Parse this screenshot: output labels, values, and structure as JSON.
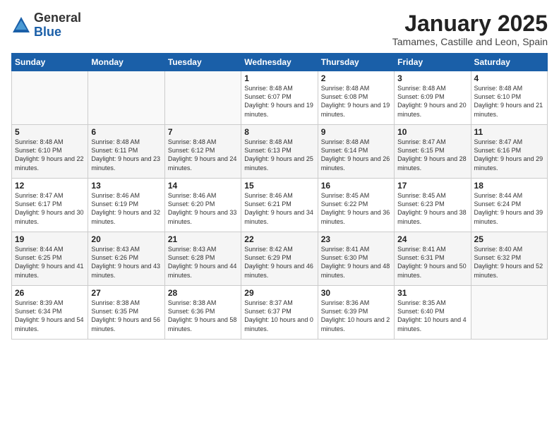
{
  "header": {
    "logo_general": "General",
    "logo_blue": "Blue",
    "month_title": "January 2025",
    "location": "Tamames, Castille and Leon, Spain"
  },
  "weekdays": [
    "Sunday",
    "Monday",
    "Tuesday",
    "Wednesday",
    "Thursday",
    "Friday",
    "Saturday"
  ],
  "weeks": [
    [
      {
        "day": "",
        "sunrise": "",
        "sunset": "",
        "daylight": ""
      },
      {
        "day": "",
        "sunrise": "",
        "sunset": "",
        "daylight": ""
      },
      {
        "day": "",
        "sunrise": "",
        "sunset": "",
        "daylight": ""
      },
      {
        "day": "1",
        "sunrise": "Sunrise: 8:48 AM",
        "sunset": "Sunset: 6:07 PM",
        "daylight": "Daylight: 9 hours and 19 minutes."
      },
      {
        "day": "2",
        "sunrise": "Sunrise: 8:48 AM",
        "sunset": "Sunset: 6:08 PM",
        "daylight": "Daylight: 9 hours and 19 minutes."
      },
      {
        "day": "3",
        "sunrise": "Sunrise: 8:48 AM",
        "sunset": "Sunset: 6:09 PM",
        "daylight": "Daylight: 9 hours and 20 minutes."
      },
      {
        "day": "4",
        "sunrise": "Sunrise: 8:48 AM",
        "sunset": "Sunset: 6:10 PM",
        "daylight": "Daylight: 9 hours and 21 minutes."
      }
    ],
    [
      {
        "day": "5",
        "sunrise": "Sunrise: 8:48 AM",
        "sunset": "Sunset: 6:10 PM",
        "daylight": "Daylight: 9 hours and 22 minutes."
      },
      {
        "day": "6",
        "sunrise": "Sunrise: 8:48 AM",
        "sunset": "Sunset: 6:11 PM",
        "daylight": "Daylight: 9 hours and 23 minutes."
      },
      {
        "day": "7",
        "sunrise": "Sunrise: 8:48 AM",
        "sunset": "Sunset: 6:12 PM",
        "daylight": "Daylight: 9 hours and 24 minutes."
      },
      {
        "day": "8",
        "sunrise": "Sunrise: 8:48 AM",
        "sunset": "Sunset: 6:13 PM",
        "daylight": "Daylight: 9 hours and 25 minutes."
      },
      {
        "day": "9",
        "sunrise": "Sunrise: 8:48 AM",
        "sunset": "Sunset: 6:14 PM",
        "daylight": "Daylight: 9 hours and 26 minutes."
      },
      {
        "day": "10",
        "sunrise": "Sunrise: 8:47 AM",
        "sunset": "Sunset: 6:15 PM",
        "daylight": "Daylight: 9 hours and 28 minutes."
      },
      {
        "day": "11",
        "sunrise": "Sunrise: 8:47 AM",
        "sunset": "Sunset: 6:16 PM",
        "daylight": "Daylight: 9 hours and 29 minutes."
      }
    ],
    [
      {
        "day": "12",
        "sunrise": "Sunrise: 8:47 AM",
        "sunset": "Sunset: 6:17 PM",
        "daylight": "Daylight: 9 hours and 30 minutes."
      },
      {
        "day": "13",
        "sunrise": "Sunrise: 8:46 AM",
        "sunset": "Sunset: 6:19 PM",
        "daylight": "Daylight: 9 hours and 32 minutes."
      },
      {
        "day": "14",
        "sunrise": "Sunrise: 8:46 AM",
        "sunset": "Sunset: 6:20 PM",
        "daylight": "Daylight: 9 hours and 33 minutes."
      },
      {
        "day": "15",
        "sunrise": "Sunrise: 8:46 AM",
        "sunset": "Sunset: 6:21 PM",
        "daylight": "Daylight: 9 hours and 34 minutes."
      },
      {
        "day": "16",
        "sunrise": "Sunrise: 8:45 AM",
        "sunset": "Sunset: 6:22 PM",
        "daylight": "Daylight: 9 hours and 36 minutes."
      },
      {
        "day": "17",
        "sunrise": "Sunrise: 8:45 AM",
        "sunset": "Sunset: 6:23 PM",
        "daylight": "Daylight: 9 hours and 38 minutes."
      },
      {
        "day": "18",
        "sunrise": "Sunrise: 8:44 AM",
        "sunset": "Sunset: 6:24 PM",
        "daylight": "Daylight: 9 hours and 39 minutes."
      }
    ],
    [
      {
        "day": "19",
        "sunrise": "Sunrise: 8:44 AM",
        "sunset": "Sunset: 6:25 PM",
        "daylight": "Daylight: 9 hours and 41 minutes."
      },
      {
        "day": "20",
        "sunrise": "Sunrise: 8:43 AM",
        "sunset": "Sunset: 6:26 PM",
        "daylight": "Daylight: 9 hours and 43 minutes."
      },
      {
        "day": "21",
        "sunrise": "Sunrise: 8:43 AM",
        "sunset": "Sunset: 6:28 PM",
        "daylight": "Daylight: 9 hours and 44 minutes."
      },
      {
        "day": "22",
        "sunrise": "Sunrise: 8:42 AM",
        "sunset": "Sunset: 6:29 PM",
        "daylight": "Daylight: 9 hours and 46 minutes."
      },
      {
        "day": "23",
        "sunrise": "Sunrise: 8:41 AM",
        "sunset": "Sunset: 6:30 PM",
        "daylight": "Daylight: 9 hours and 48 minutes."
      },
      {
        "day": "24",
        "sunrise": "Sunrise: 8:41 AM",
        "sunset": "Sunset: 6:31 PM",
        "daylight": "Daylight: 9 hours and 50 minutes."
      },
      {
        "day": "25",
        "sunrise": "Sunrise: 8:40 AM",
        "sunset": "Sunset: 6:32 PM",
        "daylight": "Daylight: 9 hours and 52 minutes."
      }
    ],
    [
      {
        "day": "26",
        "sunrise": "Sunrise: 8:39 AM",
        "sunset": "Sunset: 6:34 PM",
        "daylight": "Daylight: 9 hours and 54 minutes."
      },
      {
        "day": "27",
        "sunrise": "Sunrise: 8:38 AM",
        "sunset": "Sunset: 6:35 PM",
        "daylight": "Daylight: 9 hours and 56 minutes."
      },
      {
        "day": "28",
        "sunrise": "Sunrise: 8:38 AM",
        "sunset": "Sunset: 6:36 PM",
        "daylight": "Daylight: 9 hours and 58 minutes."
      },
      {
        "day": "29",
        "sunrise": "Sunrise: 8:37 AM",
        "sunset": "Sunset: 6:37 PM",
        "daylight": "Daylight: 10 hours and 0 minutes."
      },
      {
        "day": "30",
        "sunrise": "Sunrise: 8:36 AM",
        "sunset": "Sunset: 6:39 PM",
        "daylight": "Daylight: 10 hours and 2 minutes."
      },
      {
        "day": "31",
        "sunrise": "Sunrise: 8:35 AM",
        "sunset": "Sunset: 6:40 PM",
        "daylight": "Daylight: 10 hours and 4 minutes."
      },
      {
        "day": "",
        "sunrise": "",
        "sunset": "",
        "daylight": ""
      }
    ]
  ]
}
